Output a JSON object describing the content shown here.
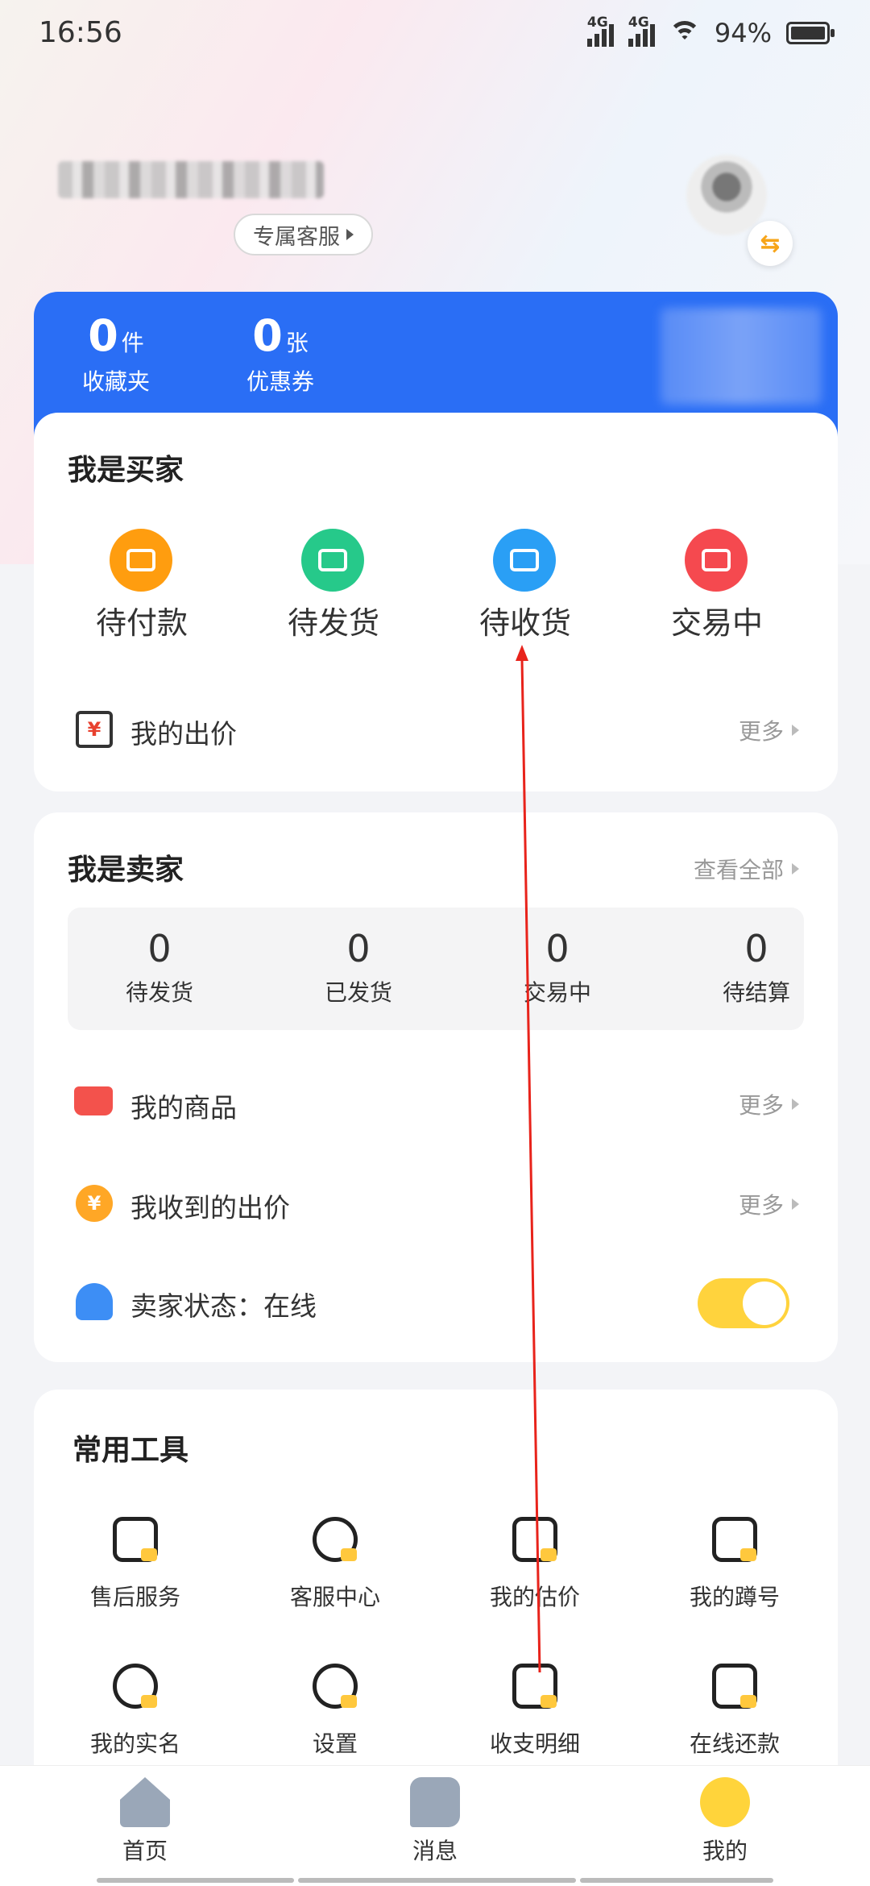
{
  "status_bar": {
    "time": "16:56",
    "network1": "4G",
    "network2": "4G",
    "battery": "94%"
  },
  "profile": {
    "service_label": "专属客服"
  },
  "stats": [
    {
      "num": "0",
      "unit": "件",
      "label": "收藏夹"
    },
    {
      "num": "0",
      "unit": "张",
      "label": "优惠券"
    }
  ],
  "buyer": {
    "title": "我是买家",
    "items": [
      {
        "label": "待付款",
        "color": "#ff9d0f"
      },
      {
        "label": "待发货",
        "color": "#26c98a"
      },
      {
        "label": "待收货",
        "color": "#2a9ff5"
      },
      {
        "label": "交易中",
        "color": "#f5494f"
      }
    ],
    "my_bids": "我的出价",
    "more": "更多"
  },
  "seller": {
    "title": "我是卖家",
    "view_all": "查看全部",
    "stats": [
      {
        "n": "0",
        "l": "待发货"
      },
      {
        "n": "0",
        "l": "已发货"
      },
      {
        "n": "0",
        "l": "交易中"
      },
      {
        "n": "0",
        "l": "待结算"
      }
    ],
    "my_goods": "我的商品",
    "received_bids": "我收到的出价",
    "more": "更多",
    "status": "卖家状态：在线",
    "online": true
  },
  "tools": {
    "title": "常用工具",
    "items": [
      {
        "label": "售后服务",
        "icon": "clipboard-icon"
      },
      {
        "label": "客服中心",
        "icon": "headset-icon"
      },
      {
        "label": "我的估价",
        "icon": "estimate-icon"
      },
      {
        "label": "我的蹲号",
        "icon": "watch-account-icon"
      },
      {
        "label": "我的实名",
        "icon": "real-name-icon"
      },
      {
        "label": "设置",
        "icon": "gear-icon"
      },
      {
        "label": "收支明细",
        "icon": "ledger-icon"
      },
      {
        "label": "在线还款",
        "icon": "wallet-icon"
      }
    ]
  },
  "nav": [
    {
      "label": "首页",
      "icon": "home-icon"
    },
    {
      "label": "消息",
      "icon": "message-icon"
    },
    {
      "label": "我的",
      "icon": "profile-icon",
      "active": true
    }
  ],
  "accent": "#2a6ef5",
  "annotation_color": "#e8231b"
}
